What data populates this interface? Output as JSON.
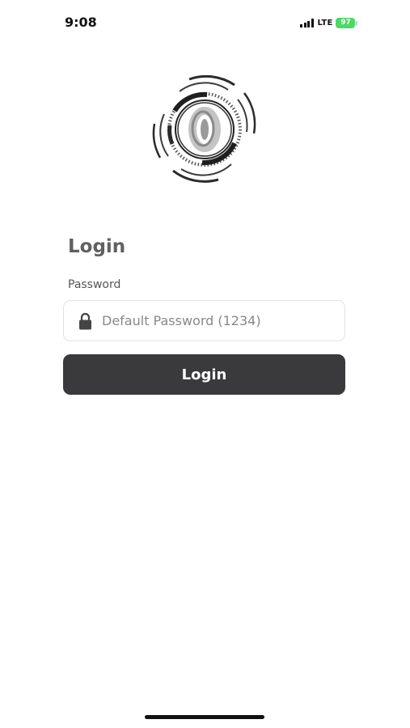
{
  "status_bar": {
    "time": "9:08",
    "network": "LTE",
    "battery": "97",
    "icons": [
      "signal-icon",
      "battery-icon"
    ]
  },
  "logo": {
    "letter": "0",
    "icon": "logo-icon"
  },
  "login": {
    "title": "Login",
    "password_label": "Password",
    "password_placeholder": "Default Password (1234)",
    "password_value": "",
    "button_label": "Login",
    "icons": [
      "lock-icon"
    ]
  },
  "colors": {
    "button_background": "#3a3a3c",
    "button_text": "#ffffff",
    "battery": "#4cd964",
    "title_text": "#606060"
  }
}
